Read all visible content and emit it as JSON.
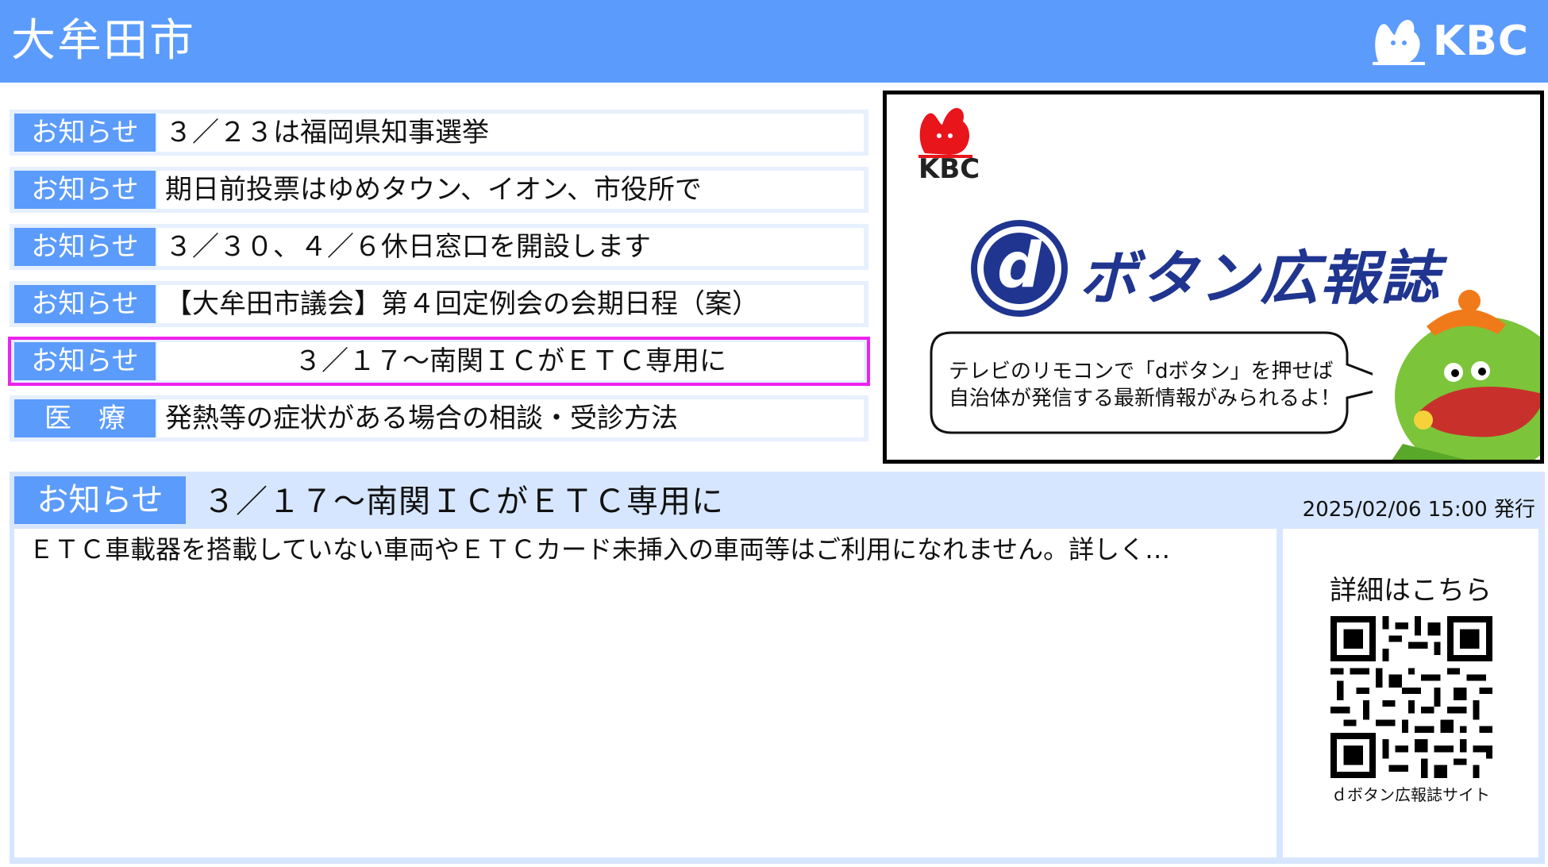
{
  "header": {
    "city_title": "大牟田市",
    "logo_text": "KBC"
  },
  "notices": [
    {
      "tag": "お知らせ",
      "text": "３／２３は福岡県知事選挙"
    },
    {
      "tag": "お知らせ",
      "text": "期日前投票はゆめタウン、イオン、市役所で"
    },
    {
      "tag": "お知らせ",
      "text": "３／３０、４／６休日窓口を開設します"
    },
    {
      "tag": "お知らせ",
      "text": "【大牟田市議会】第４回定例会の会期日程（案）"
    },
    {
      "tag": "お知らせ",
      "text": "３／１７～南関ＩＣがＥＴＣ専用に",
      "selected": true
    },
    {
      "tag": "医　療",
      "text": "発熱等の症状がある場合の相談・受診方法"
    }
  ],
  "promo": {
    "logo_text": "KBC",
    "d_mark": "d",
    "title": "ボタン広報誌",
    "bubble_line1": "テレビのリモコンで「dボタン」を押せば",
    "bubble_line2": "自治体が発信する最新情報がみられるよ！"
  },
  "detail": {
    "tag": "お知らせ",
    "title": "３／１７～南関ＩＣがＥＴＣ専用に",
    "issued": "2025/02/06 15:00 発行",
    "body": "ＥＴＣ車載器を搭載していない車両やＥＴＣカード未挿入の車両等はご利用になれません。詳しく…",
    "qr_caption": "詳細はこちら",
    "qr_sub": "ｄボタン広報誌サイト"
  },
  "colors": {
    "header_blue": "#5b9bfb",
    "row_bg": "#e6f0ff",
    "detail_bg": "#d6e6fe",
    "selected_outline": "#ee22ee",
    "promo_navy": "#1f3590"
  }
}
